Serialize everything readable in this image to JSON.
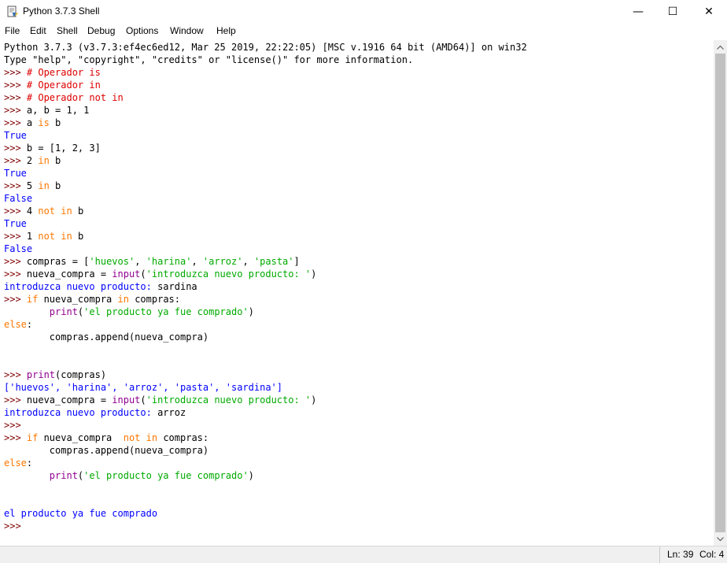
{
  "window": {
    "title": "Python 3.7.3 Shell",
    "icon": "python-idle-icon",
    "controls": {
      "minimize": "—",
      "maximize": "☐",
      "close": "✕"
    }
  },
  "menu": [
    "File",
    "Edit",
    "Shell",
    "Debug",
    "Options",
    "Window",
    "Help"
  ],
  "lines": [
    [
      {
        "t": "Python 3.7.3 (v3.7.3:ef4ec6ed12, Mar 25 2019, 22:22:05) [MSC v.1916 64 bit (AMD64)] on win32",
        "c": "normal"
      }
    ],
    [
      {
        "t": "Type \"help\", \"copyright\", \"credits\" or \"license()\" for more information.",
        "c": "normal"
      }
    ],
    [
      {
        "t": ">>> ",
        "c": "prompt"
      },
      {
        "t": "# Operador is",
        "c": "comment"
      }
    ],
    [
      {
        "t": ">>> ",
        "c": "prompt"
      },
      {
        "t": "# Operador in",
        "c": "comment"
      }
    ],
    [
      {
        "t": ">>> ",
        "c": "prompt"
      },
      {
        "t": "# Operador not in",
        "c": "comment"
      }
    ],
    [
      {
        "t": ">>> ",
        "c": "prompt"
      },
      {
        "t": "a, b = 1, 1",
        "c": "normal"
      }
    ],
    [
      {
        "t": ">>> ",
        "c": "prompt"
      },
      {
        "t": "a ",
        "c": "normal"
      },
      {
        "t": "is",
        "c": "kw"
      },
      {
        "t": " b",
        "c": "normal"
      }
    ],
    [
      {
        "t": "True",
        "c": "out"
      }
    ],
    [
      {
        "t": ">>> ",
        "c": "prompt"
      },
      {
        "t": "b = [1, 2, 3]",
        "c": "normal"
      }
    ],
    [
      {
        "t": ">>> ",
        "c": "prompt"
      },
      {
        "t": "2 ",
        "c": "normal"
      },
      {
        "t": "in",
        "c": "kw"
      },
      {
        "t": " b",
        "c": "normal"
      }
    ],
    [
      {
        "t": "True",
        "c": "out"
      }
    ],
    [
      {
        "t": ">>> ",
        "c": "prompt"
      },
      {
        "t": "5 ",
        "c": "normal"
      },
      {
        "t": "in",
        "c": "kw"
      },
      {
        "t": " b",
        "c": "normal"
      }
    ],
    [
      {
        "t": "False",
        "c": "out"
      }
    ],
    [
      {
        "t": ">>> ",
        "c": "prompt"
      },
      {
        "t": "4 ",
        "c": "normal"
      },
      {
        "t": "not in",
        "c": "kw"
      },
      {
        "t": " b",
        "c": "normal"
      }
    ],
    [
      {
        "t": "True",
        "c": "out"
      }
    ],
    [
      {
        "t": ">>> ",
        "c": "prompt"
      },
      {
        "t": "1 ",
        "c": "normal"
      },
      {
        "t": "not in",
        "c": "kw"
      },
      {
        "t": " b",
        "c": "normal"
      }
    ],
    [
      {
        "t": "False",
        "c": "out"
      }
    ],
    [
      {
        "t": ">>> ",
        "c": "prompt"
      },
      {
        "t": "compras = [",
        "c": "normal"
      },
      {
        "t": "'huevos'",
        "c": "str"
      },
      {
        "t": ", ",
        "c": "normal"
      },
      {
        "t": "'harina'",
        "c": "str"
      },
      {
        "t": ", ",
        "c": "normal"
      },
      {
        "t": "'arroz'",
        "c": "str"
      },
      {
        "t": ", ",
        "c": "normal"
      },
      {
        "t": "'pasta'",
        "c": "str"
      },
      {
        "t": "]",
        "c": "normal"
      }
    ],
    [
      {
        "t": ">>> ",
        "c": "prompt"
      },
      {
        "t": "nueva_compra = ",
        "c": "normal"
      },
      {
        "t": "input",
        "c": "builtin"
      },
      {
        "t": "(",
        "c": "normal"
      },
      {
        "t": "'introduzca nuevo producto: '",
        "c": "str"
      },
      {
        "t": ")",
        "c": "normal"
      }
    ],
    [
      {
        "t": "introduzca nuevo producto: ",
        "c": "out"
      },
      {
        "t": "sardina",
        "c": "normal"
      }
    ],
    [
      {
        "t": ">>> ",
        "c": "prompt"
      },
      {
        "t": "if",
        "c": "kw"
      },
      {
        "t": " nueva_compra ",
        "c": "normal"
      },
      {
        "t": "in",
        "c": "kw"
      },
      {
        "t": " compras:",
        "c": "normal"
      }
    ],
    [
      {
        "t": "        ",
        "c": "normal"
      },
      {
        "t": "print",
        "c": "builtin"
      },
      {
        "t": "(",
        "c": "normal"
      },
      {
        "t": "'el producto ya fue comprado'",
        "c": "str"
      },
      {
        "t": ")",
        "c": "normal"
      }
    ],
    [
      {
        "t": "else",
        "c": "kw"
      },
      {
        "t": ":",
        "c": "normal"
      }
    ],
    [
      {
        "t": "        compras.append(nueva_compra)",
        "c": "normal"
      }
    ],
    [],
    [],
    [
      {
        "t": ">>> ",
        "c": "prompt"
      },
      {
        "t": "print",
        "c": "builtin"
      },
      {
        "t": "(compras)",
        "c": "normal"
      }
    ],
    [
      {
        "t": "['huevos', 'harina', 'arroz', 'pasta', 'sardina']",
        "c": "out"
      }
    ],
    [
      {
        "t": ">>> ",
        "c": "prompt"
      },
      {
        "t": "nueva_compra = ",
        "c": "normal"
      },
      {
        "t": "input",
        "c": "builtin"
      },
      {
        "t": "(",
        "c": "normal"
      },
      {
        "t": "'introduzca nuevo producto: '",
        "c": "str"
      },
      {
        "t": ")",
        "c": "normal"
      }
    ],
    [
      {
        "t": "introduzca nuevo producto: ",
        "c": "out"
      },
      {
        "t": "arroz",
        "c": "normal"
      }
    ],
    [
      {
        "t": ">>> ",
        "c": "prompt"
      }
    ],
    [
      {
        "t": ">>> ",
        "c": "prompt"
      },
      {
        "t": "if",
        "c": "kw"
      },
      {
        "t": " nueva_compra  ",
        "c": "normal"
      },
      {
        "t": "not in",
        "c": "kw"
      },
      {
        "t": " compras:",
        "c": "normal"
      }
    ],
    [
      {
        "t": "        compras.append(nueva_compra)",
        "c": "normal"
      }
    ],
    [
      {
        "t": "else",
        "c": "kw"
      },
      {
        "t": ":",
        "c": "normal"
      }
    ],
    [
      {
        "t": "        ",
        "c": "normal"
      },
      {
        "t": "print",
        "c": "builtin"
      },
      {
        "t": "(",
        "c": "normal"
      },
      {
        "t": "'el producto ya fue comprado'",
        "c": "str"
      },
      {
        "t": ")",
        "c": "normal"
      }
    ],
    [],
    [],
    [
      {
        "t": "el producto ya fue comprado",
        "c": "out"
      }
    ],
    [
      {
        "t": ">>> ",
        "c": "prompt"
      }
    ]
  ],
  "status": {
    "line": "Ln: 39",
    "col": "Col: 4"
  },
  "colors": {
    "prompt": "#800000",
    "comment": "#dd0000",
    "keyword": "#ff7700",
    "builtin": "#900090",
    "string": "#00aa00",
    "output": "#0000ff"
  }
}
